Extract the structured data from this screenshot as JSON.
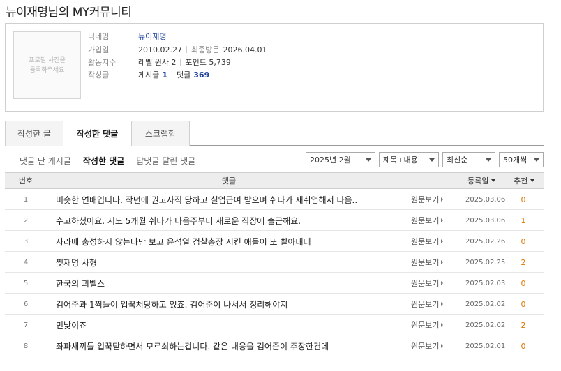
{
  "page_title": "뉴이재명님의 MY커뮤니티",
  "profile": {
    "photo_placeholder": "프로필 사진을\n등록하주세요",
    "nickname_label": "닉네임",
    "nickname": "뉴이재명",
    "joined_label": "가입일",
    "joined": "2010.02.27",
    "last_visit_label": "최종방문",
    "last_visit": "2026.04.01",
    "activity_label": "활동지수",
    "level": "레벨 원사 2",
    "points": "포인트 5,739",
    "posts_label": "작성글",
    "post_count_label": "게시글",
    "post_count": "1",
    "comment_count_label": "댓글",
    "comment_count": "369"
  },
  "tabs": [
    {
      "label": "작성한 글",
      "active": false
    },
    {
      "label": "작성한 댓글",
      "active": true
    },
    {
      "label": "스크랩함",
      "active": false
    }
  ],
  "subnav": [
    {
      "label": "댓글 단 게시글",
      "active": false
    },
    {
      "label": "작성한 댓글",
      "active": true
    },
    {
      "label": "답댓글 달린 댓글",
      "active": false
    }
  ],
  "filters": {
    "month": "2025년 2월",
    "search_scope": "제목+내용",
    "sort": "최신순",
    "per_page": "50개씩"
  },
  "table": {
    "headers": {
      "no": "번호",
      "comment": "댓글",
      "date": "등록일",
      "recommend": "추천"
    },
    "view_original": "원문보기",
    "rows": [
      {
        "no": "1",
        "text": "비슷한 연배입니다. 작년에 권고사직 당하고 실업급여 받으며 쉬다가 재취업해서 다음..",
        "date": "2025.03.06",
        "rec": "0"
      },
      {
        "no": "2",
        "text": "수고하셨어요. 저도 5개월 쉬다가 다음주부터 새로운 직장에 출근해요.",
        "date": "2025.03.06",
        "rec": "1"
      },
      {
        "no": "3",
        "text": "사라메 충성하지 않는다만 보고 윤석열 검찰총장 시킨 애들이 또 빨아대데",
        "date": "2025.02.26",
        "rec": "0"
      },
      {
        "no": "4",
        "text": "찢재명 사형",
        "date": "2025.02.25",
        "rec": "2"
      },
      {
        "no": "5",
        "text": "한국의 괴벨스",
        "date": "2025.02.03",
        "rec": "0"
      },
      {
        "no": "6",
        "text": "김어준과 1찍들이 입꾹쳐당하고 있죠. 김어준이 나서서 정리해야지",
        "date": "2025.02.02",
        "rec": "0"
      },
      {
        "no": "7",
        "text": "민낯이죠",
        "date": "2025.02.02",
        "rec": "2"
      },
      {
        "no": "8",
        "text": "좌파새끼들 입꾹닫하면서 모르쇠하는겁니다. 같은 내용을 김어준이 주장한건데",
        "date": "2025.02.01",
        "rec": "0"
      }
    ]
  }
}
